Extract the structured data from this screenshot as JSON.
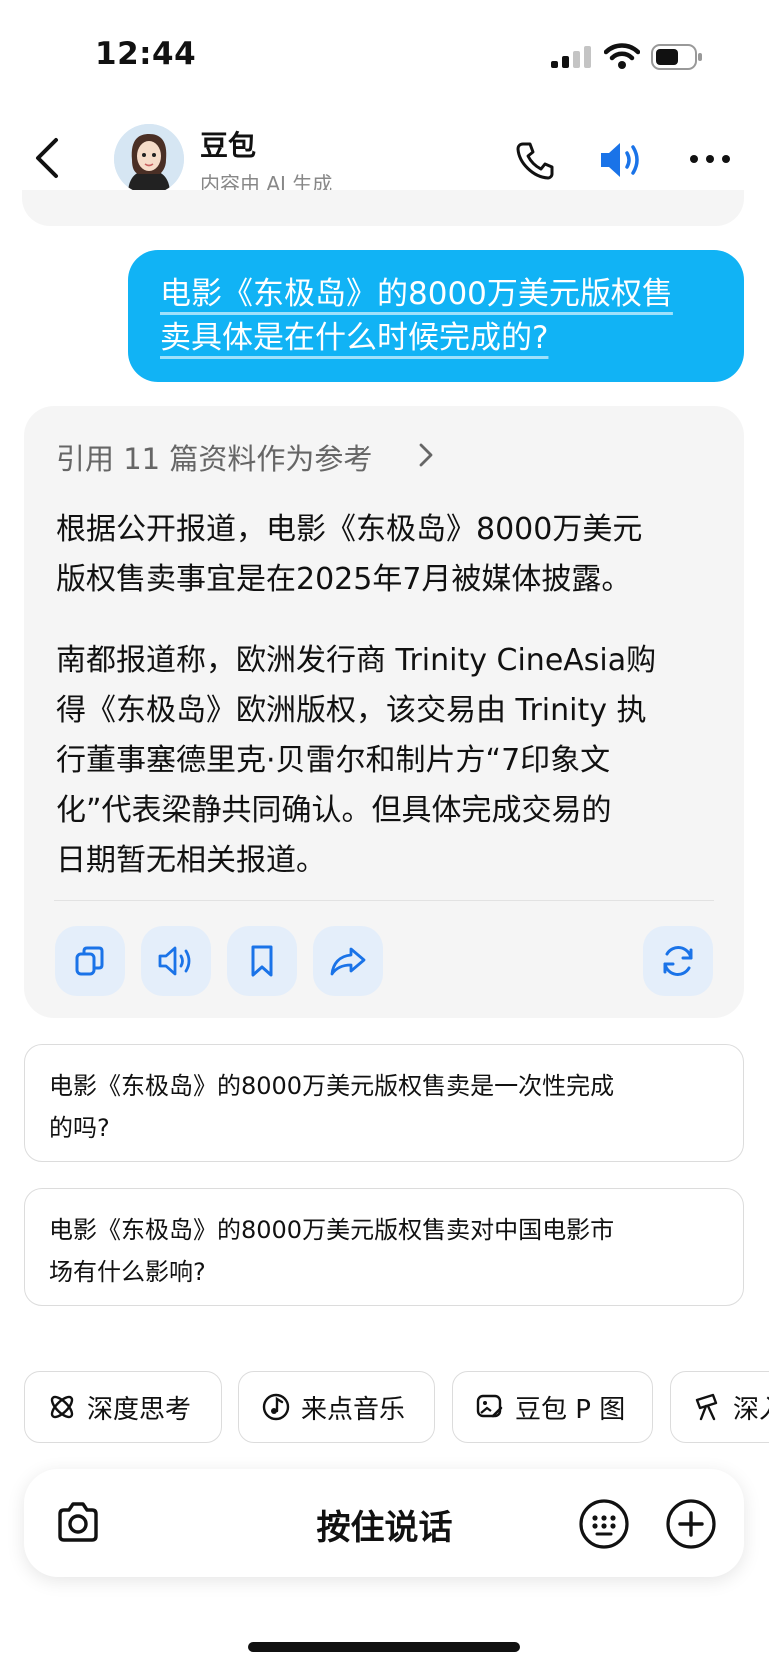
{
  "status_bar": {
    "time": "12:44"
  },
  "header": {
    "title": "豆包",
    "subtitle": "内容由 AI 生成"
  },
  "user_message": {
    "line1": "电影《东极岛》的8000万美元版权售",
    "line2": "卖具体是在什么时候完成的?"
  },
  "answer": {
    "references_label": "引用 11 篇资料作为参考",
    "para1": [
      "根据公开报道，电影《东极岛》8000万美元",
      "版权售卖事宜是在2025年7月被媒体披露。"
    ],
    "para2": [
      "南都报道称，欧洲发行商 Trinity CineAsia购",
      "得《东极岛》欧洲版权，该交易由 Trinity 执",
      "行董事塞德里克·贝雷尔和制片方“7印象文",
      "化”代表梁静共同确认。但具体完成交易的",
      "日期暂无相关报道。"
    ]
  },
  "suggestions": [
    {
      "line1": "电影《东极岛》的8000万美元版权售卖是一次性完成",
      "line2": "的吗?"
    },
    {
      "line1": "电影《东极岛》的8000万美元版权售卖对中国电影市",
      "line2": "场有什么影响?"
    }
  ],
  "chips": [
    {
      "label": "深度思考",
      "icon": "atom-icon"
    },
    {
      "label": "来点音乐",
      "icon": "music-icon"
    },
    {
      "label": "豆包 P 图",
      "icon": "image-edit-icon"
    },
    {
      "label": "深入",
      "icon": "telescope-icon"
    }
  ],
  "input_bar": {
    "label": "按住说话"
  },
  "colors": {
    "accent": "#1a73e8",
    "user_bubble": "#11b3f5",
    "card_bg": "#f5f5f5"
  }
}
